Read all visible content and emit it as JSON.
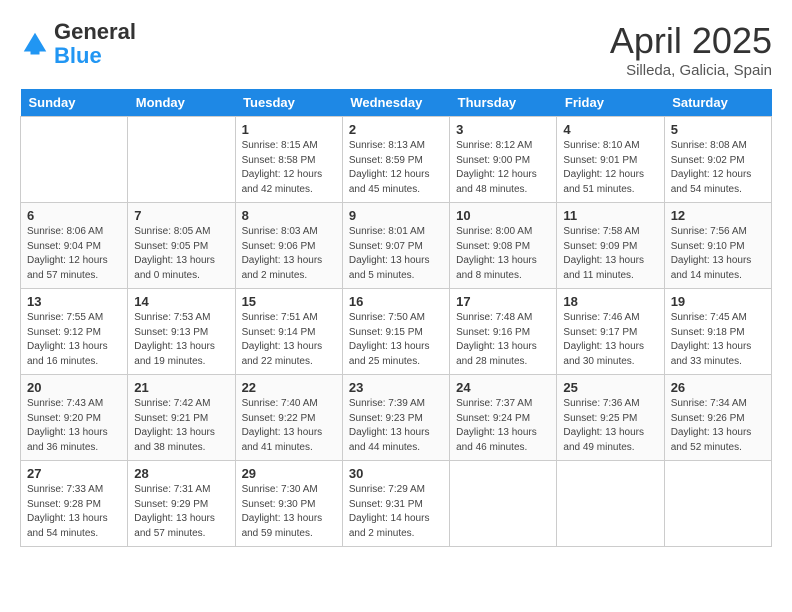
{
  "header": {
    "logo_line1": "General",
    "logo_line2": "Blue",
    "month_year": "April 2025",
    "location": "Silleda, Galicia, Spain"
  },
  "weekdays": [
    "Sunday",
    "Monday",
    "Tuesday",
    "Wednesday",
    "Thursday",
    "Friday",
    "Saturday"
  ],
  "weeks": [
    [
      {
        "day": "",
        "sunrise": "",
        "sunset": "",
        "daylight": ""
      },
      {
        "day": "",
        "sunrise": "",
        "sunset": "",
        "daylight": ""
      },
      {
        "day": "1",
        "sunrise": "Sunrise: 8:15 AM",
        "sunset": "Sunset: 8:58 PM",
        "daylight": "Daylight: 12 hours and 42 minutes."
      },
      {
        "day": "2",
        "sunrise": "Sunrise: 8:13 AM",
        "sunset": "Sunset: 8:59 PM",
        "daylight": "Daylight: 12 hours and 45 minutes."
      },
      {
        "day": "3",
        "sunrise": "Sunrise: 8:12 AM",
        "sunset": "Sunset: 9:00 PM",
        "daylight": "Daylight: 12 hours and 48 minutes."
      },
      {
        "day": "4",
        "sunrise": "Sunrise: 8:10 AM",
        "sunset": "Sunset: 9:01 PM",
        "daylight": "Daylight: 12 hours and 51 minutes."
      },
      {
        "day": "5",
        "sunrise": "Sunrise: 8:08 AM",
        "sunset": "Sunset: 9:02 PM",
        "daylight": "Daylight: 12 hours and 54 minutes."
      }
    ],
    [
      {
        "day": "6",
        "sunrise": "Sunrise: 8:06 AM",
        "sunset": "Sunset: 9:04 PM",
        "daylight": "Daylight: 12 hours and 57 minutes."
      },
      {
        "day": "7",
        "sunrise": "Sunrise: 8:05 AM",
        "sunset": "Sunset: 9:05 PM",
        "daylight": "Daylight: 13 hours and 0 minutes."
      },
      {
        "day": "8",
        "sunrise": "Sunrise: 8:03 AM",
        "sunset": "Sunset: 9:06 PM",
        "daylight": "Daylight: 13 hours and 2 minutes."
      },
      {
        "day": "9",
        "sunrise": "Sunrise: 8:01 AM",
        "sunset": "Sunset: 9:07 PM",
        "daylight": "Daylight: 13 hours and 5 minutes."
      },
      {
        "day": "10",
        "sunrise": "Sunrise: 8:00 AM",
        "sunset": "Sunset: 9:08 PM",
        "daylight": "Daylight: 13 hours and 8 minutes."
      },
      {
        "day": "11",
        "sunrise": "Sunrise: 7:58 AM",
        "sunset": "Sunset: 9:09 PM",
        "daylight": "Daylight: 13 hours and 11 minutes."
      },
      {
        "day": "12",
        "sunrise": "Sunrise: 7:56 AM",
        "sunset": "Sunset: 9:10 PM",
        "daylight": "Daylight: 13 hours and 14 minutes."
      }
    ],
    [
      {
        "day": "13",
        "sunrise": "Sunrise: 7:55 AM",
        "sunset": "Sunset: 9:12 PM",
        "daylight": "Daylight: 13 hours and 16 minutes."
      },
      {
        "day": "14",
        "sunrise": "Sunrise: 7:53 AM",
        "sunset": "Sunset: 9:13 PM",
        "daylight": "Daylight: 13 hours and 19 minutes."
      },
      {
        "day": "15",
        "sunrise": "Sunrise: 7:51 AM",
        "sunset": "Sunset: 9:14 PM",
        "daylight": "Daylight: 13 hours and 22 minutes."
      },
      {
        "day": "16",
        "sunrise": "Sunrise: 7:50 AM",
        "sunset": "Sunset: 9:15 PM",
        "daylight": "Daylight: 13 hours and 25 minutes."
      },
      {
        "day": "17",
        "sunrise": "Sunrise: 7:48 AM",
        "sunset": "Sunset: 9:16 PM",
        "daylight": "Daylight: 13 hours and 28 minutes."
      },
      {
        "day": "18",
        "sunrise": "Sunrise: 7:46 AM",
        "sunset": "Sunset: 9:17 PM",
        "daylight": "Daylight: 13 hours and 30 minutes."
      },
      {
        "day": "19",
        "sunrise": "Sunrise: 7:45 AM",
        "sunset": "Sunset: 9:18 PM",
        "daylight": "Daylight: 13 hours and 33 minutes."
      }
    ],
    [
      {
        "day": "20",
        "sunrise": "Sunrise: 7:43 AM",
        "sunset": "Sunset: 9:20 PM",
        "daylight": "Daylight: 13 hours and 36 minutes."
      },
      {
        "day": "21",
        "sunrise": "Sunrise: 7:42 AM",
        "sunset": "Sunset: 9:21 PM",
        "daylight": "Daylight: 13 hours and 38 minutes."
      },
      {
        "day": "22",
        "sunrise": "Sunrise: 7:40 AM",
        "sunset": "Sunset: 9:22 PM",
        "daylight": "Daylight: 13 hours and 41 minutes."
      },
      {
        "day": "23",
        "sunrise": "Sunrise: 7:39 AM",
        "sunset": "Sunset: 9:23 PM",
        "daylight": "Daylight: 13 hours and 44 minutes."
      },
      {
        "day": "24",
        "sunrise": "Sunrise: 7:37 AM",
        "sunset": "Sunset: 9:24 PM",
        "daylight": "Daylight: 13 hours and 46 minutes."
      },
      {
        "day": "25",
        "sunrise": "Sunrise: 7:36 AM",
        "sunset": "Sunset: 9:25 PM",
        "daylight": "Daylight: 13 hours and 49 minutes."
      },
      {
        "day": "26",
        "sunrise": "Sunrise: 7:34 AM",
        "sunset": "Sunset: 9:26 PM",
        "daylight": "Daylight: 13 hours and 52 minutes."
      }
    ],
    [
      {
        "day": "27",
        "sunrise": "Sunrise: 7:33 AM",
        "sunset": "Sunset: 9:28 PM",
        "daylight": "Daylight: 13 hours and 54 minutes."
      },
      {
        "day": "28",
        "sunrise": "Sunrise: 7:31 AM",
        "sunset": "Sunset: 9:29 PM",
        "daylight": "Daylight: 13 hours and 57 minutes."
      },
      {
        "day": "29",
        "sunrise": "Sunrise: 7:30 AM",
        "sunset": "Sunset: 9:30 PM",
        "daylight": "Daylight: 13 hours and 59 minutes."
      },
      {
        "day": "30",
        "sunrise": "Sunrise: 7:29 AM",
        "sunset": "Sunset: 9:31 PM",
        "daylight": "Daylight: 14 hours and 2 minutes."
      },
      {
        "day": "",
        "sunrise": "",
        "sunset": "",
        "daylight": ""
      },
      {
        "day": "",
        "sunrise": "",
        "sunset": "",
        "daylight": ""
      },
      {
        "day": "",
        "sunrise": "",
        "sunset": "",
        "daylight": ""
      }
    ]
  ]
}
